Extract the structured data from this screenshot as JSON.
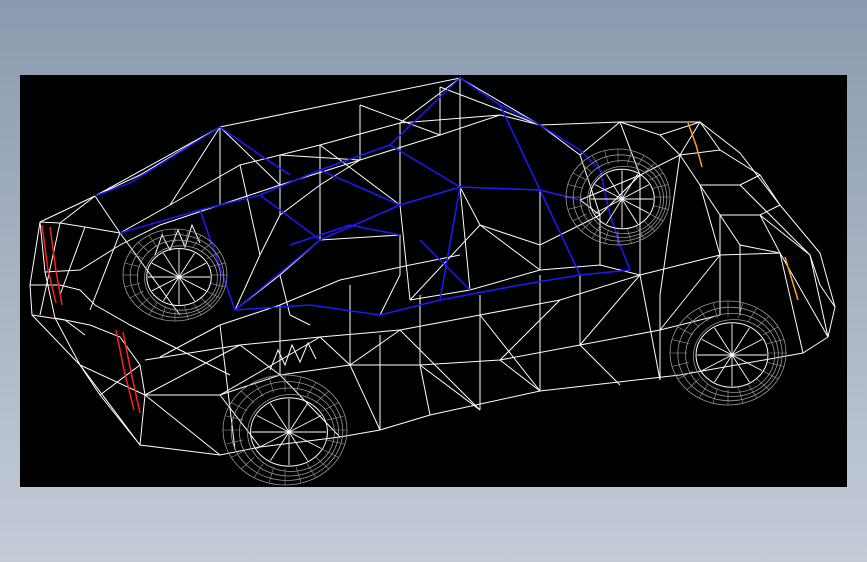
{
  "background": {
    "gradient_top": "#8b9aaf",
    "gradient_bottom": "#c5ccd8"
  },
  "viewport": {
    "background_color": "#000000"
  },
  "model": {
    "subject": "car-wireframe",
    "colors": {
      "mesh": "#ffffff",
      "roof_edges": "#1a1aff",
      "wheel_mesh": "#9a9a9a",
      "tail_light": "#ff2020",
      "head_light": "#ffa020"
    },
    "wheel_count": 4
  }
}
